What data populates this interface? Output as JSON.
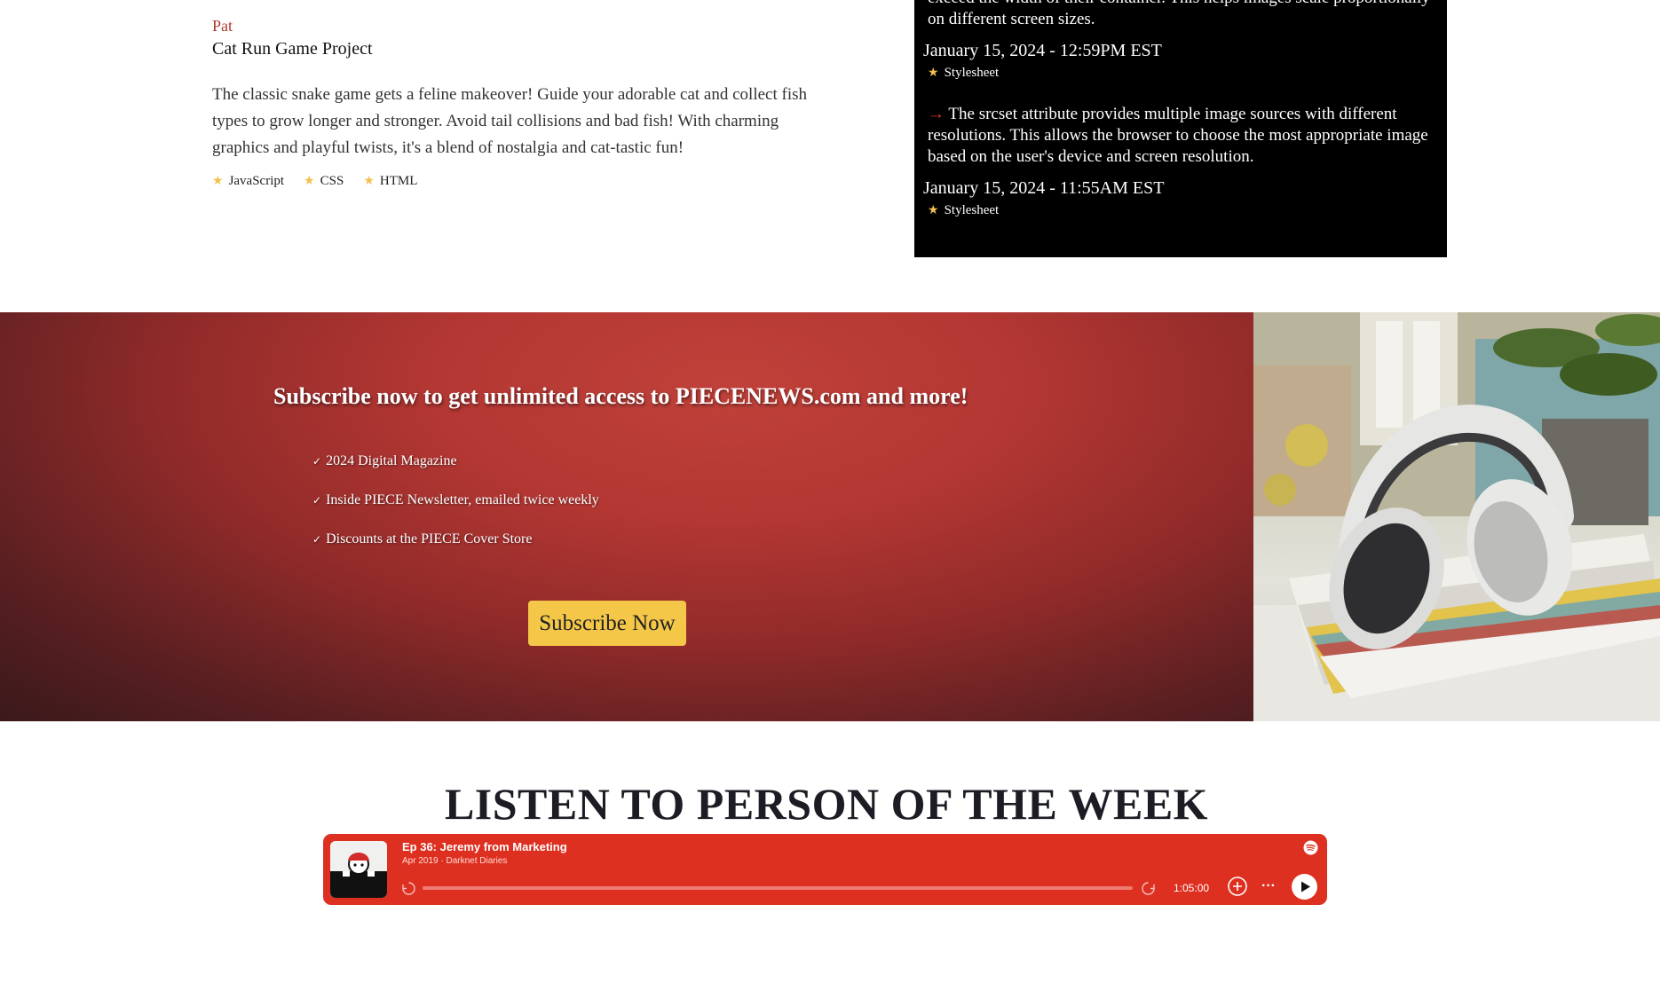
{
  "project": {
    "author": "Pat",
    "title": "Cat Run Game Project",
    "description": "The classic snake game gets a feline makeover! Guide your adorable cat and collect fish types to grow longer and stronger. Avoid tail collisions and bad fish! With charming graphics and playful twists, it's a blend of nostalgia and cat-tastic fun!",
    "tags": [
      "JavaScript",
      "CSS",
      "HTML"
    ]
  },
  "changelog": {
    "entries": [
      {
        "text": "exceed the width of their container. This helps images scale proportionally on different screen sizes.",
        "date": "January 15, 2024 - 12:59PM EST",
        "tag": "Stylesheet"
      },
      {
        "arrow": "→",
        "text": "The srcset attribute provides multiple image sources with different resolutions. This allows the browser to choose the most appropriate image based on the user's device and screen resolution.",
        "date": "January 15, 2024 - 11:55AM EST",
        "tag": "Stylesheet"
      }
    ]
  },
  "subscribe": {
    "title": "Subscribe now to get unlimited access to PIECENEWS.com and more!",
    "benefits": [
      "2024 Digital Magazine",
      "Inside PIECE Newsletter, emailed twice weekly",
      "Discounts at the PIECE Cover Store"
    ],
    "button_label": "Subscribe Now"
  },
  "listen": {
    "title": "LISTEN TO PERSON OF THE WEEK",
    "player": {
      "episode_title": "Ep 36: Jeremy from Marketing",
      "meta": "Apr 2019 · Darknet Diaries",
      "duration": "1:05:00",
      "more": "···",
      "progress": 0
    }
  },
  "colors": {
    "accent_red": "#b03a2e",
    "button_yellow": "#f5c748",
    "player_red": "#de3021",
    "star": "#f2c14e"
  }
}
